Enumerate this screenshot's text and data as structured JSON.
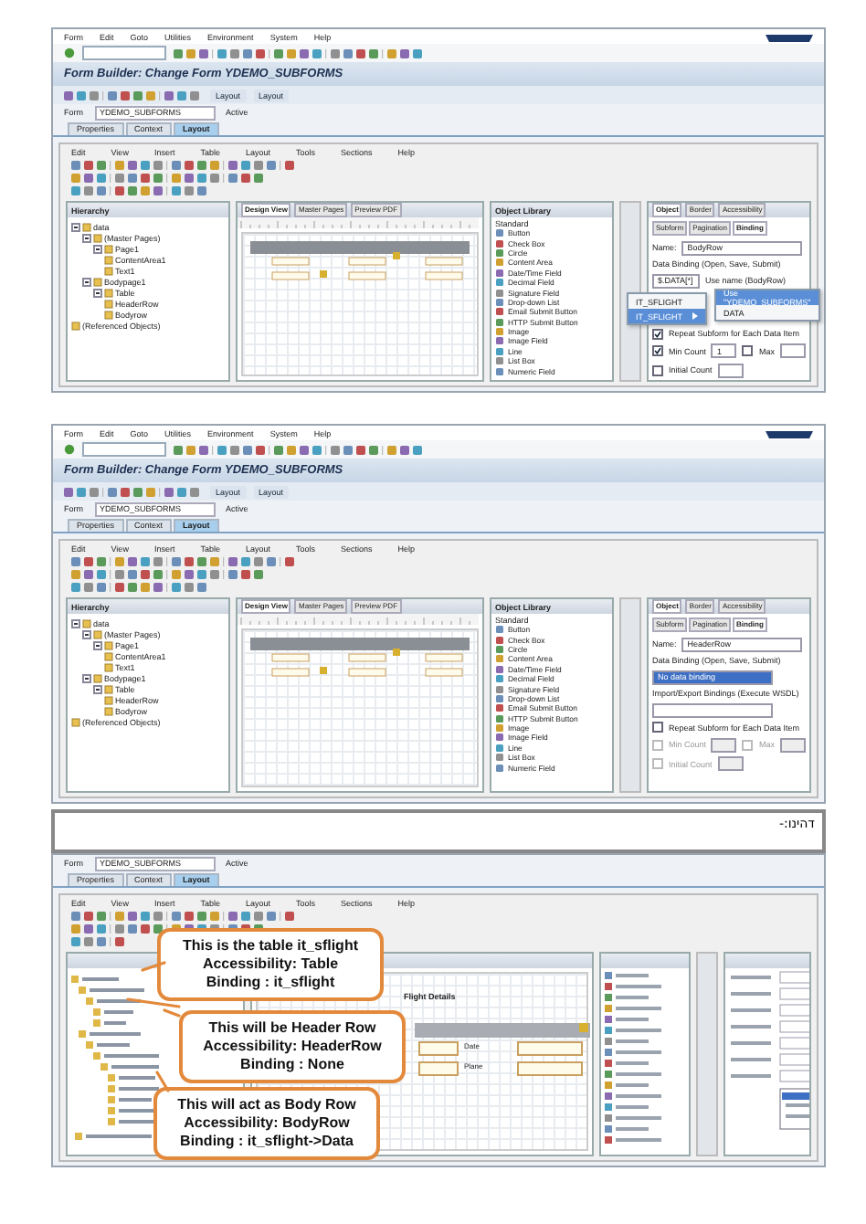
{
  "screens": [
    {
      "kind": "full",
      "menu": [
        "Form",
        "Edit",
        "Goto",
        "Utilities",
        "Environment",
        "System",
        "Help"
      ],
      "title": "Form Builder: Change Form YDEMO_SUBFORMS",
      "app_buttons": [
        "Layout",
        "Layout"
      ],
      "form": {
        "label": "Form",
        "value": "YDEMO_SUBFORMS",
        "status": "Active"
      },
      "tabs": [
        {
          "label": "Properties",
          "selected": false
        },
        {
          "label": "Context",
          "selected": false
        },
        {
          "label": "Layout",
          "selected": true
        }
      ],
      "designer_menu": [
        "Edit",
        "View",
        "Insert",
        "Table",
        "Layout",
        "Tools",
        "Sections",
        "Help"
      ],
      "hierarchy": {
        "title": "Hierarchy",
        "tree": [
          {
            "label": "data",
            "expanded": true,
            "children": [
              {
                "label": "(Master Pages)",
                "expanded": true,
                "children": [
                  {
                    "label": "Page1",
                    "expanded": true,
                    "children": [
                      {
                        "label": "ContentArea1"
                      },
                      {
                        "label": "Text1"
                      }
                    ]
                  }
                ]
              },
              {
                "label": "Bodypage1",
                "expanded": true,
                "children": [
                  {
                    "label": "Table",
                    "expanded": true,
                    "children": [
                      {
                        "label": "HeaderRow"
                      },
                      {
                        "label": "Bodyrow"
                      }
                    ]
                  }
                ]
              }
            ]
          },
          {
            "label": "(Referenced Objects)"
          }
        ]
      },
      "design_tabs": [
        {
          "label": "Design View",
          "selected": true
        },
        {
          "label": "Master Pages",
          "selected": false
        },
        {
          "label": "Preview PDF",
          "selected": false
        }
      ],
      "library": {
        "title": "Object Library",
        "group": "Standard",
        "items": [
          "Button",
          "Check Box",
          "Circle",
          "Content Area",
          "Date/Time Field",
          "Decimal Field",
          "Signature Field",
          "Drop-down List",
          "Email Submit Button",
          "HTTP Submit Button",
          "Image",
          "Image Field",
          "Line",
          "List Box",
          "Numeric Field"
        ]
      },
      "palette": {
        "tabs": [
          {
            "label": "Object",
            "selected": true
          },
          {
            "label": "Border",
            "selected": false
          },
          {
            "label": "Accessibility",
            "selected": false
          }
        ],
        "subtabs": [
          {
            "label": "Subform",
            "selected": false
          },
          {
            "label": "Pagination",
            "selected": false
          },
          {
            "label": "Binding",
            "selected": true
          }
        ],
        "rows": [
          {
            "kind": "field",
            "label": "Name:",
            "value": "BodyRow",
            "highlighted": false
          },
          {
            "kind": "label",
            "text": "Data Binding (Open, Save, Submit)"
          },
          {
            "kind": "binding",
            "value": "$.DATA[*]",
            "note": "Use name (BodyRow)"
          },
          {
            "kind": "check",
            "label": "Repeat Subform for Each Data Item",
            "checked": true,
            "disabled": false
          },
          {
            "kind": "counts",
            "items": [
              {
                "label": "Min Count",
                "checked": true,
                "disabled": false,
                "value": "1"
              },
              {
                "label": "Max",
                "checked": false,
                "disabled": false
              }
            ]
          },
          {
            "kind": "counts",
            "items": [
              {
                "label": "Initial Count",
                "checked": false,
                "disabled": false
              }
            ]
          }
        ]
      },
      "popup": {
        "items": [
          {
            "label": "IT_SFLIGHT",
            "selected": false,
            "submenu": false
          },
          {
            "label": "IT_SFLIGHT",
            "selected": true,
            "submenu": true
          }
        ],
        "submenu": [
          {
            "label": "Use \"YDEMO_SUBFORMS\"",
            "selected": true
          },
          {
            "label": "DATA",
            "selected": false
          }
        ]
      }
    },
    {
      "kind": "full",
      "menu": [
        "Form",
        "Edit",
        "Goto",
        "Utilities",
        "Environment",
        "System",
        "Help"
      ],
      "title": "Form Builder: Change Form YDEMO_SUBFORMS",
      "app_buttons": [
        "Layout",
        "Layout"
      ],
      "form": {
        "label": "Form",
        "value": "YDEMO_SUBFORMS",
        "status": "Active"
      },
      "tabs": [
        {
          "label": "Properties",
          "selected": false
        },
        {
          "label": "Context",
          "selected": false
        },
        {
          "label": "Layout",
          "selected": true
        }
      ],
      "designer_menu": [
        "Edit",
        "View",
        "Insert",
        "Table",
        "Layout",
        "Tools",
        "Sections",
        "Help"
      ],
      "hierarchy": {
        "title": "Hierarchy",
        "tree": [
          {
            "label": "data",
            "expanded": true,
            "children": [
              {
                "label": "(Master Pages)",
                "expanded": true,
                "children": [
                  {
                    "label": "Page1",
                    "expanded": true,
                    "children": [
                      {
                        "label": "ContentArea1"
                      },
                      {
                        "label": "Text1"
                      }
                    ]
                  }
                ]
              },
              {
                "label": "Bodypage1",
                "expanded": true,
                "children": [
                  {
                    "label": "Table",
                    "expanded": true,
                    "children": [
                      {
                        "label": "HeaderRow"
                      },
                      {
                        "label": "Bodyrow"
                      }
                    ]
                  }
                ]
              }
            ]
          },
          {
            "label": "(Referenced Objects)"
          }
        ]
      },
      "design_tabs": [
        {
          "label": "Design View",
          "selected": true
        },
        {
          "label": "Master Pages",
          "selected": false
        },
        {
          "label": "Preview PDF",
          "selected": false
        }
      ],
      "library": {
        "title": "Object Library",
        "group": "Standard",
        "items": [
          "Button",
          "Check Box",
          "Circle",
          "Content Area",
          "Date/Time Field",
          "Decimal Field",
          "Signature Field",
          "Drop-down List",
          "Email Submit Button",
          "HTTP Submit Button",
          "Image",
          "Image Field",
          "Line",
          "List Box",
          "Numeric Field"
        ]
      },
      "palette": {
        "tabs": [
          {
            "label": "Object",
            "selected": true
          },
          {
            "label": "Border",
            "selected": false
          },
          {
            "label": "Accessibility",
            "selected": false
          }
        ],
        "subtabs": [
          {
            "label": "Subform",
            "selected": false
          },
          {
            "label": "Pagination",
            "selected": false
          },
          {
            "label": "Binding",
            "selected": true
          }
        ],
        "rows": [
          {
            "kind": "field",
            "label": "Name:",
            "value": "HeaderRow",
            "highlighted": false
          },
          {
            "kind": "label",
            "text": "Data Binding (Open, Save, Submit)"
          },
          {
            "kind": "field",
            "value": "No data binding",
            "highlighted": true
          },
          {
            "kind": "label",
            "text": "Import/Export Bindings (Execute WSDL)"
          },
          {
            "kind": "field",
            "highlighted": false
          },
          {
            "kind": "check",
            "label": "Repeat Subform for Each Data Item",
            "checked": false,
            "disabled": false
          },
          {
            "kind": "counts",
            "items": [
              {
                "label": "Min Count",
                "checked": false,
                "disabled": true
              },
              {
                "label": "Max",
                "checked": false,
                "disabled": true
              }
            ]
          },
          {
            "kind": "counts",
            "items": [
              {
                "label": "Initial Count",
                "checked": false,
                "disabled": true
              }
            ]
          }
        ]
      }
    }
  ],
  "note": {
    "text": "דהינו:-"
  },
  "annotated_screen": {
    "kind": "partial",
    "form": {
      "label": "Form",
      "value": "YDEMO_SUBFORMS",
      "status": "Active"
    },
    "tabs": [
      {
        "label": "Properties",
        "selected": false
      },
      {
        "label": "Context",
        "selected": false
      },
      {
        "label": "Layout",
        "selected": true
      }
    ],
    "designer_menu": [
      "Edit",
      "View",
      "Insert",
      "Table",
      "Layout",
      "Tools",
      "Sections",
      "Help"
    ],
    "canvas": {
      "heading": "Flight Details",
      "rows": [
        {
          "label": "Date"
        },
        {
          "label": "Plane"
        }
      ]
    },
    "callouts": [
      "This is the table it_sflight\nAccessibility: Table\nBinding : it_sflight",
      "This will be Header Row\nAccessibility: HeaderRow\nBinding : None",
      "This will act as Body Row\nAccessibility: BodyRow\nBinding : it_sflight->Data"
    ]
  }
}
